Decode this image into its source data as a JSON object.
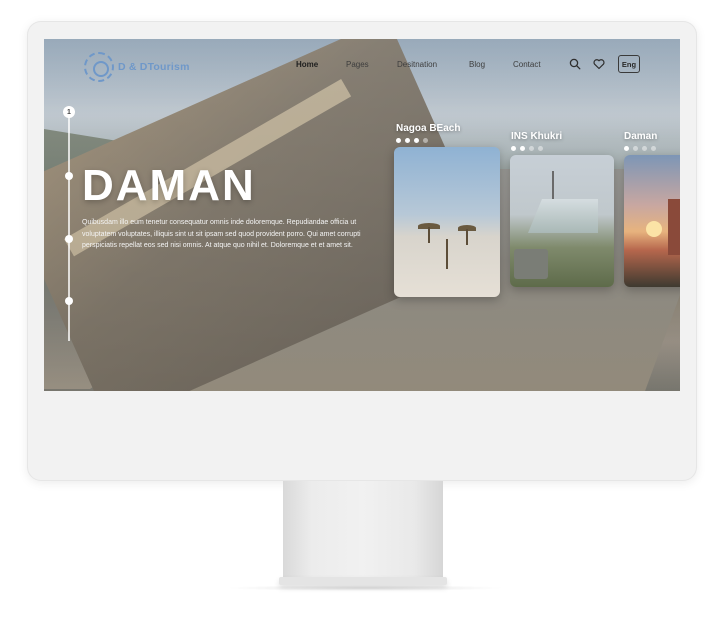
{
  "brand": {
    "name": "D & DTourism",
    "accent": "#6f98c9"
  },
  "nav": {
    "items": [
      {
        "label": "Home",
        "active": true
      },
      {
        "label": "Pages",
        "active": false
      },
      {
        "label": "Desitnation",
        "active": false
      },
      {
        "label": "Blog",
        "active": false
      },
      {
        "label": "Contact",
        "active": false
      }
    ],
    "icons": [
      "search-icon",
      "heart-icon"
    ],
    "language": "Eng"
  },
  "slider": {
    "current_index": "1",
    "dot_count": 3
  },
  "hero": {
    "title": "DAMAN",
    "description": "Quibusdam illo eum tenetur consequatur omnis inde doloremque. Repudiandae officia ut voluptatem voluptates, illiquis sint ut sit ipsam sed quod provident porro. Qui amet corrupti perspiciatis repellat eos sed nisi omnis. At atque quo nihil et. Doloremque et et amet sit."
  },
  "cards": [
    {
      "title": "Nagoa BEach",
      "dots_active": 3,
      "dots_total": 4
    },
    {
      "title": "INS Khukri",
      "dots_active": 2,
      "dots_total": 4
    },
    {
      "title": "Daman",
      "dots_active": 1,
      "dots_total": 4
    }
  ]
}
